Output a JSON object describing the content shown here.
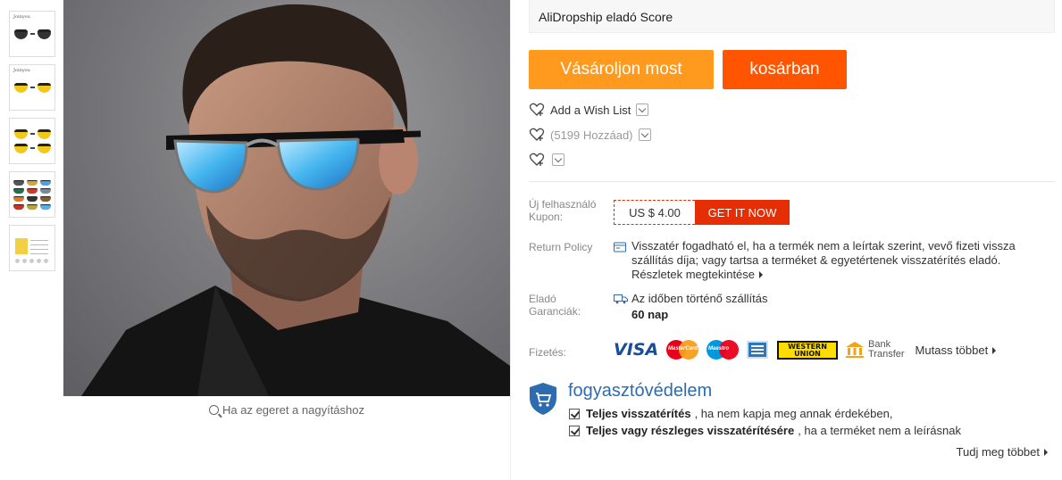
{
  "thumbnails": {
    "brand_text": "Joinyou",
    "items": [
      {
        "name": "thumb-black-glasses"
      },
      {
        "name": "thumb-yellow-glasses"
      },
      {
        "name": "thumb-yellow-pair"
      },
      {
        "name": "thumb-color-grid"
      },
      {
        "name": "thumb-size-chart"
      }
    ]
  },
  "gallery": {
    "zoom_hint": "Ha az egeret a nagyításhoz"
  },
  "seller": {
    "score_label": "AliDropship eladó Score"
  },
  "actions": {
    "buy_now": "Vásároljon most",
    "add_to_cart": "kosárban",
    "wish_list": "Add a Wish List",
    "wish_count": "(5199 Hozzáad)"
  },
  "coupon": {
    "label": "Új felhasználó Kupon:",
    "amount": "US $ 4.00",
    "button": "GET IT NOW"
  },
  "return_policy": {
    "label": "Return Policy",
    "text": "Visszatér fogadható el, ha a termék nem a leírtak szerint, vevő fizeti vissza szállítás díja; vagy tartsa a terméket & egyetértenek visszatérítés eladó.",
    "link": "Részletek megtekintése"
  },
  "guarantee": {
    "label": "Eladó Garanciák:",
    "text": "Az időben történő szállítás",
    "days": "60 nap"
  },
  "payment": {
    "label": "Fizetés:",
    "visa": "VISA",
    "mastercard": "MasterCard",
    "maestro": "Maestro",
    "western_union": "WESTERN UNION",
    "bank_transfer_line1": "Bank",
    "bank_transfer_line2": "Transfer",
    "more": "Mutass többet"
  },
  "protection": {
    "title": "fogyasztóvédelem",
    "line1_bold": "Teljes visszatérítés",
    "line1_rest": ", ha nem kapja meg annak érdekében,",
    "line2_bold": "Teljes vagy részleges visszatérítésére",
    "line2_rest": ", ha a terméket nem a leírásnak",
    "learn_more": "Tudj meg többet"
  },
  "colors": {
    "buy_now": "#ff9a1f",
    "cart": "#ff5500",
    "coupon_red": "#e62e04",
    "protection_blue": "#2d6cb0"
  }
}
